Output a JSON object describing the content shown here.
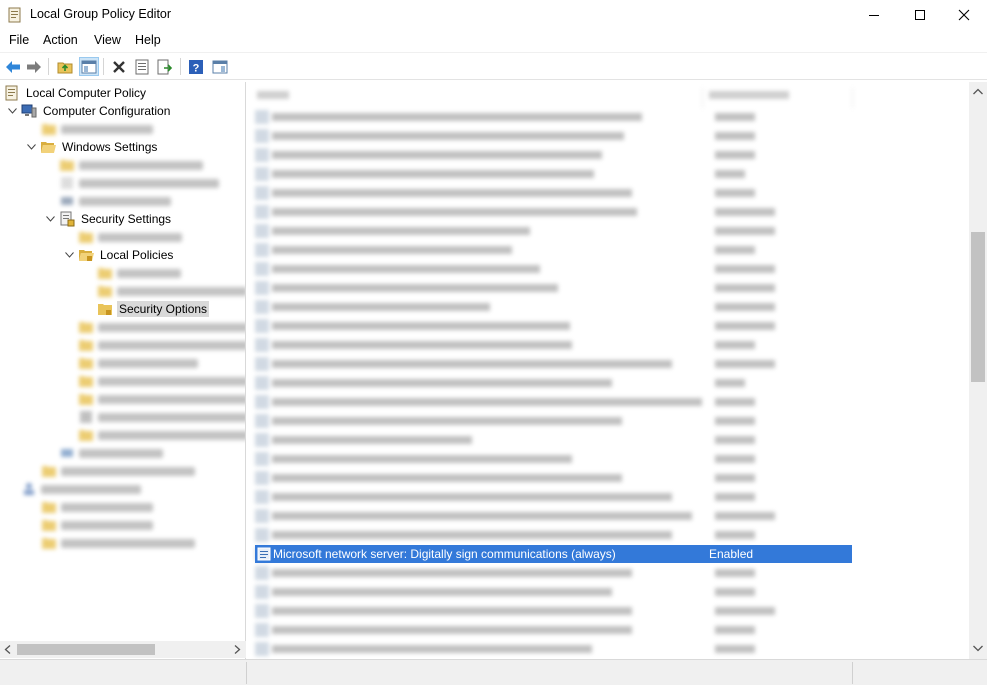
{
  "window": {
    "title": "Local Group Policy Editor"
  },
  "menu": [
    "File",
    "Action",
    "View",
    "Help"
  ],
  "toolbar": {
    "buttons": [
      "back-icon",
      "forward-icon",
      "up-folder-icon",
      "show-hide-tree-icon",
      "delete-icon",
      "properties-icon",
      "export-list-icon",
      "help-icon",
      "console-view-icon"
    ]
  },
  "tree": {
    "root": "Local Computer Policy",
    "computer_config": "Computer Configuration",
    "windows_settings": "Windows Settings",
    "security_settings": "Security Settings",
    "local_policies": "Local Policies",
    "security_options": "Security Options"
  },
  "selected_policy": {
    "name": "Microsoft network server: Digitally sign communications (always)",
    "setting": "Enabled"
  },
  "colors": {
    "selection": "#3379d9",
    "tree_selection": "#d9d9d9"
  }
}
